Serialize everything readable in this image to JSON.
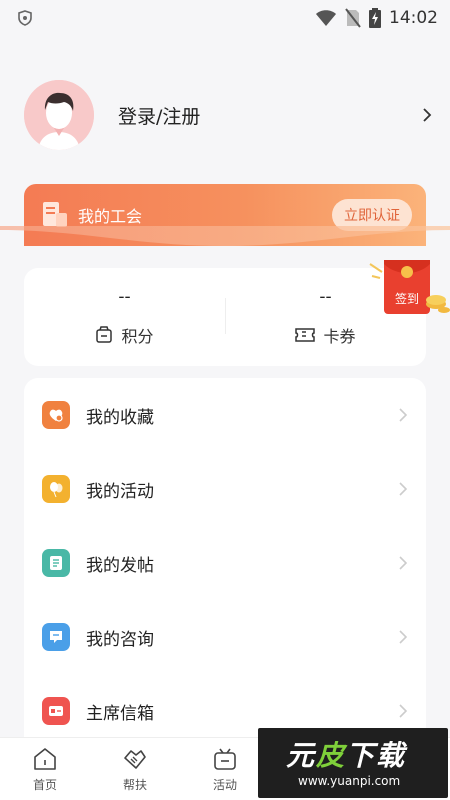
{
  "status": {
    "time": "14:02"
  },
  "profile": {
    "login_label": "登录/注册"
  },
  "union": {
    "title": "我的工会",
    "verify_label": "立即认证"
  },
  "points": {
    "points_value": "--",
    "points_label": "积分",
    "cards_value": "--",
    "cards_label": "卡券"
  },
  "signin": {
    "label": "签到"
  },
  "menu": {
    "items": [
      {
        "label": "我的收藏",
        "color": "#f0813f",
        "icon": "heart-plus-icon"
      },
      {
        "label": "我的活动",
        "color": "#f3b12f",
        "icon": "balloon-icon"
      },
      {
        "label": "我的发帖",
        "color": "#49b8a6",
        "icon": "document-icon"
      },
      {
        "label": "我的咨询",
        "color": "#4a9fe8",
        "icon": "chat-icon"
      },
      {
        "label": "主席信箱",
        "color": "#ef5450",
        "icon": "mailbox-icon"
      }
    ]
  },
  "tabs": [
    {
      "label": "首页",
      "icon": "home-icon"
    },
    {
      "label": "帮扶",
      "icon": "handshake-icon"
    },
    {
      "label": "活动",
      "icon": "activity-icon"
    }
  ],
  "watermark": {
    "title_a": "元",
    "title_b": "皮",
    "title_c": "下载",
    "url": "www.yuanpi.com"
  }
}
